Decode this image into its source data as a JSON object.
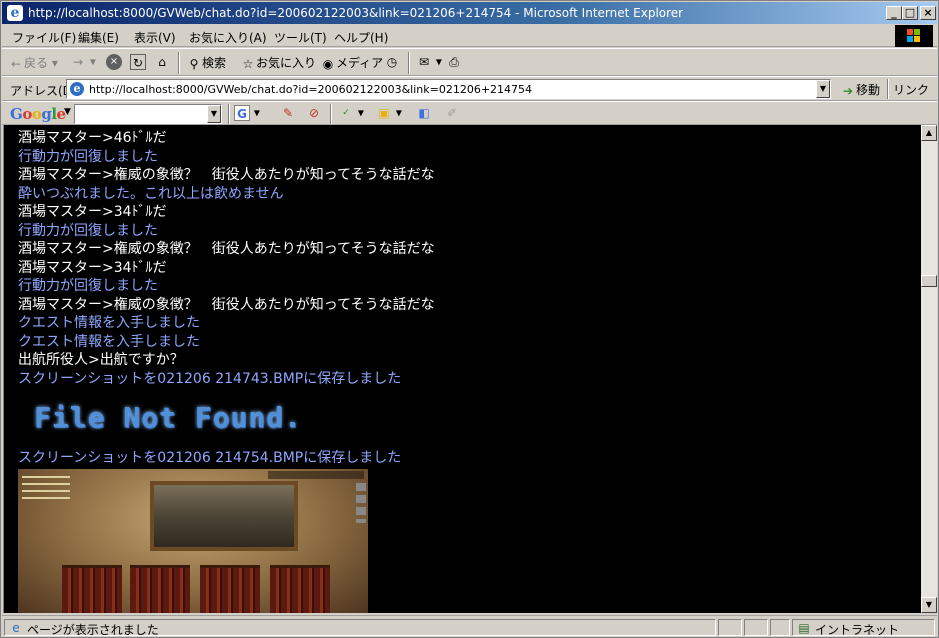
{
  "window": {
    "title": "http://localhost:8000/GVWeb/chat.do?id=200602122003&link=021206+214754 - Microsoft Internet Explorer"
  },
  "menu": [
    "ファイル(F)",
    "編集(E)",
    "表示(V)",
    "お気に入り(A)",
    "ツール(T)",
    "ヘルプ(H)"
  ],
  "toolbar": {
    "back": "戻る",
    "search": "検索",
    "favorites": "お気に入り",
    "media": "メディア"
  },
  "address": {
    "label": "アドレス(D)",
    "url": "http://localhost:8000/GVWeb/chat.do?id=200602122003&link=021206+214754",
    "go": "移動",
    "links": "リンク"
  },
  "google": {
    "logo": "Google",
    "search_value": ""
  },
  "chat": {
    "lines": [
      {
        "text": "酒場マスター>46ﾄﾞﾙだ",
        "color": "#ffffff"
      },
      {
        "text": "行動力が回復しました",
        "color": "#8fa6ff"
      },
      {
        "text": "酒場マスター>権威の象徴？　街役人あたりが知ってそうな話だな",
        "color": "#ffffff"
      },
      {
        "text": "酔いつぶれました。これ以上は飲めません",
        "color": "#8fa6ff"
      },
      {
        "text": "酒場マスター>34ﾄﾞﾙだ",
        "color": "#ffffff"
      },
      {
        "text": "行動力が回復しました",
        "color": "#8fa6ff"
      },
      {
        "text": "酒場マスター>権威の象徴？　街役人あたりが知ってそうな話だな",
        "color": "#ffffff"
      },
      {
        "text": "酒場マスター>34ﾄﾞﾙだ",
        "color": "#ffffff"
      },
      {
        "text": "行動力が回復しました",
        "color": "#8fa6ff"
      },
      {
        "text": "酒場マスター>権威の象徴？　街役人あたりが知ってそうな話だな",
        "color": "#ffffff"
      },
      {
        "text": "クエスト情報を入手しました",
        "color": "#8fa6ff"
      },
      {
        "text": "クエスト情報を入手しました",
        "color": "#8fa6ff"
      },
      {
        "text": "出航所役人>出航ですか？",
        "color": "#ffffff"
      },
      {
        "text": "スクリーンショットを021206 214743.BMPに保存しました",
        "color": "#8fa6ff"
      }
    ],
    "not_found": "File Not Found.",
    "after_line": "スクリーンショットを021206 214754.BMPに保存しました"
  },
  "status": {
    "text": "ページが表示されました",
    "zone": "イントラネット"
  }
}
